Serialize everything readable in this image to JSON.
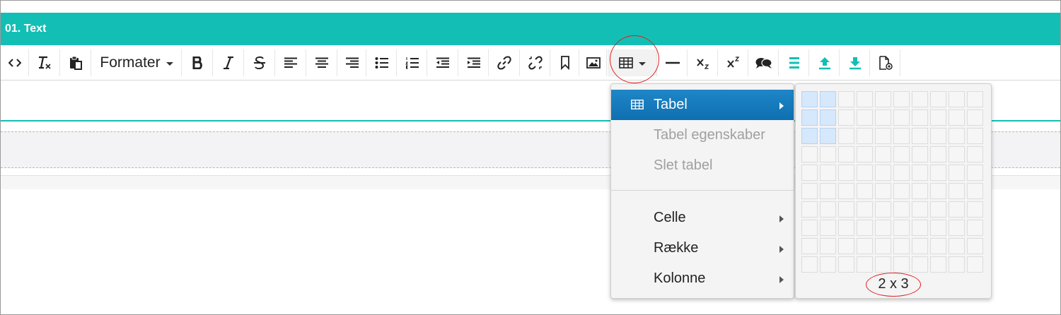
{
  "header": {
    "title": "01. Text"
  },
  "toolbar": {
    "formater_label": "Formater",
    "buttons": [
      "source-code",
      "clear-formatting",
      "paste",
      "formater",
      "bold",
      "italic",
      "strikethrough",
      "align-left",
      "align-center",
      "align-right",
      "bullet-list",
      "numbered-list",
      "outdent",
      "indent",
      "link",
      "unlink",
      "bookmark",
      "image",
      "table",
      "horizontal-rule",
      "subscript",
      "superscript",
      "comment",
      "accent-list",
      "upload",
      "download",
      "new-document"
    ],
    "accent_color": "#13bfb4"
  },
  "menu": {
    "items": [
      {
        "label": "Tabel",
        "state": "active",
        "has_submenu": true,
        "icon": "table-icon"
      },
      {
        "label": "Tabel egenskaber",
        "state": "disabled",
        "has_submenu": false
      },
      {
        "label": "Slet tabel",
        "state": "disabled",
        "has_submenu": false
      },
      {
        "label": "Celle",
        "state": "normal",
        "has_submenu": true
      },
      {
        "label": "Række",
        "state": "normal",
        "has_submenu": true
      },
      {
        "label": "Kolonne",
        "state": "normal",
        "has_submenu": true
      }
    ],
    "active_color": "#1579bd"
  },
  "grid_picker": {
    "columns": 10,
    "rows": 10,
    "selected_columns": 2,
    "selected_rows": 3,
    "size_label": "2 x 3"
  },
  "annotation_color": "#e02020"
}
